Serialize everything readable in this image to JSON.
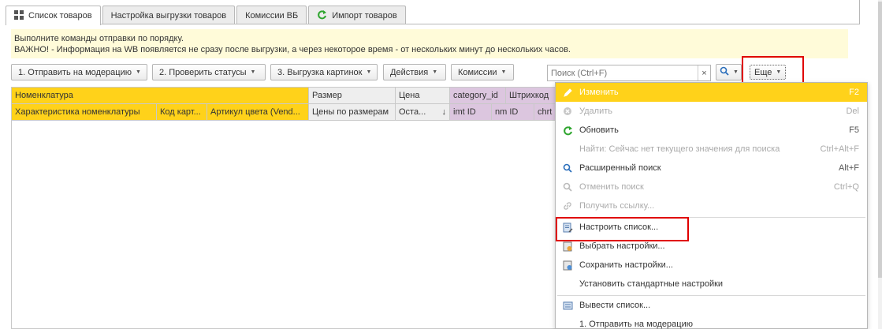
{
  "tabs": [
    {
      "label": "Список товаров",
      "icon": "grid-icon"
    },
    {
      "label": "Настройка выгрузки товаров"
    },
    {
      "label": "Комиссии ВБ"
    },
    {
      "label": "Импорт товаров",
      "icon": "refresh-icon"
    }
  ],
  "notice": {
    "line1": "Выполните команды отправки по порядку.",
    "line2": "ВАЖНО! - Информация на WB появляется не сразу после выгрузки, а через некоторое время - от нескольких минут до нескольких часов."
  },
  "toolbar": {
    "buttons": [
      "1. Отправить на модерацию",
      "2. Проверить статусы",
      "3. Выгрузка картинок",
      "Действия",
      "Комиссии"
    ],
    "search_placeholder": "Поиск (Ctrl+F)",
    "search_clear": "×",
    "more_label": "Еще"
  },
  "grid": {
    "header_row1": [
      "Номенклатура",
      "Размер",
      "Цена",
      "category_id",
      "Штрихкод"
    ],
    "header_row2": [
      "Характеристика номенклатуры",
      "Код карт...",
      "Артикул цвета (Vend...",
      "Цены по размерам",
      "Оста...",
      "imt ID",
      "nm ID",
      "chrt"
    ],
    "sort_arrow": "↓"
  },
  "menu": {
    "items": [
      {
        "label": "Изменить",
        "shortcut": "F2",
        "icon": "pencil-icon",
        "state": "selected"
      },
      {
        "label": "Удалить",
        "shortcut": "Del",
        "icon": "delete-icon",
        "state": "disabled"
      },
      {
        "label": "Обновить",
        "shortcut": "F5",
        "icon": "refresh-icon",
        "state": "normal"
      },
      {
        "label": "Найти: Сейчас нет текущего значения для поиска",
        "shortcut": "Ctrl+Alt+F",
        "icon": "",
        "state": "disabled"
      },
      {
        "label": "Расширенный поиск",
        "shortcut": "Alt+F",
        "icon": "search-icon",
        "state": "normal"
      },
      {
        "label": "Отменить поиск",
        "shortcut": "Ctrl+Q",
        "icon": "cancel-search-icon",
        "state": "disabled"
      },
      {
        "label": "Получить ссылку...",
        "shortcut": "",
        "icon": "link-icon",
        "state": "disabled"
      },
      {
        "label": "Настроить список...",
        "shortcut": "",
        "icon": "list-settings-icon",
        "state": "normal"
      },
      {
        "label": "Выбрать настройки...",
        "shortcut": "",
        "icon": "load-settings-icon",
        "state": "normal"
      },
      {
        "label": "Сохранить настройки...",
        "shortcut": "",
        "icon": "save-settings-icon",
        "state": "normal"
      },
      {
        "label": "Установить стандартные настройки",
        "shortcut": "",
        "icon": "",
        "state": "normal"
      },
      {
        "label": "Вывести список...",
        "shortcut": "",
        "icon": "print-list-icon",
        "state": "normal"
      },
      {
        "label": "1. Отправить на модерацию",
        "shortcut": "",
        "icon": "",
        "state": "normal"
      }
    ]
  },
  "colors": {
    "accent_yellow": "#ffd21a",
    "notice_bg": "#fffbd9",
    "highlight_red": "#e00000",
    "purple_header": "#dcc6df"
  }
}
